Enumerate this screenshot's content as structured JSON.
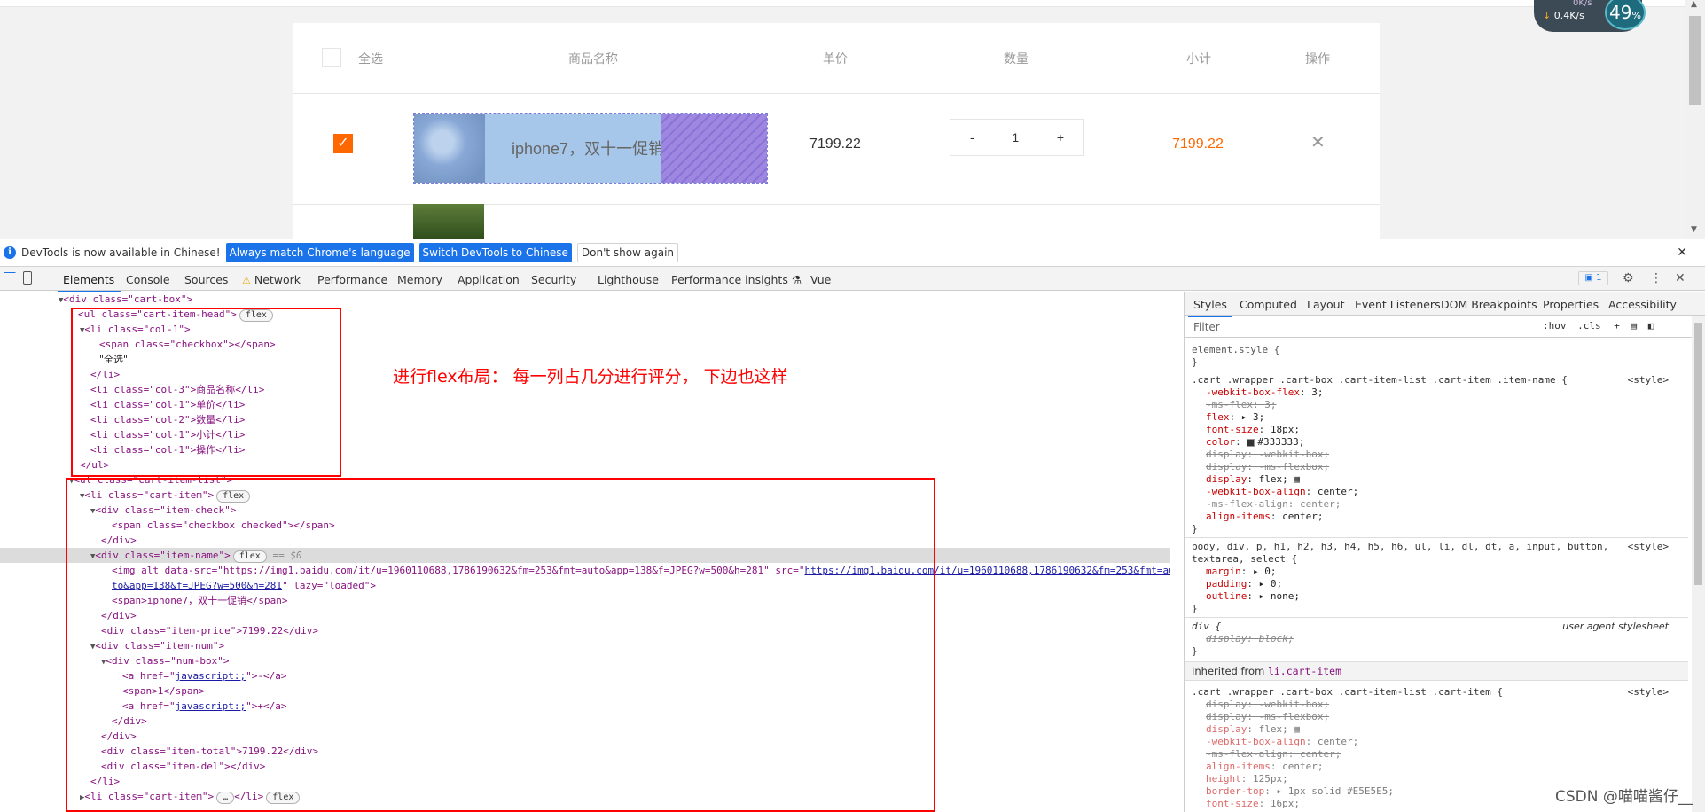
{
  "cart": {
    "head": {
      "select_all": "全选",
      "name": "商品名称",
      "price": "单价",
      "quantity": "数量",
      "subtotal": "小计",
      "operation": "操作"
    },
    "item": {
      "name": "iphone7，双十一促销",
      "price": "7199.22",
      "minus": "-",
      "quantity": "1",
      "plus": "+",
      "total": "7199.22",
      "delete": "✕"
    }
  },
  "speed_widget": {
    "up": "0K/s",
    "down": "0.4K/s",
    "percent": "49",
    "percent_unit": "%"
  },
  "infobar": {
    "message": "DevTools is now available in Chinese!",
    "btn_match": "Always match Chrome's language",
    "btn_switch": "Switch DevTools to Chinese",
    "btn_dismiss": "Don't show again",
    "close": "✕"
  },
  "tabs": [
    "Elements",
    "Console",
    "Sources",
    "Network",
    "Performance",
    "Memory",
    "Application",
    "Security",
    "Lighthouse",
    "Performance insights",
    "Vue"
  ],
  "message_badge": "1",
  "styles_tabs": [
    "Styles",
    "Computed",
    "Layout",
    "Event Listeners",
    "DOM Breakpoints",
    "Properties",
    "Accessibility"
  ],
  "filter": {
    "placeholder": "Filter",
    "hov": ":hov",
    "cls": ".cls",
    "plus": "+"
  },
  "annotation": "进行flex布局：  每一列占几分进行评分，  下边也这样",
  "dom": {
    "cart_box": "<div class=\"cart-box\">",
    "ul_head": "<ul class=\"cart-item-head\">",
    "li_col1": "<li class=\"col-1\">",
    "span_checkbox": "<span class=\"checkbox\"></span>",
    "text_all": "\"全选\"",
    "li_close": "</li>",
    "li_col3": "<li class=\"col-3\">商品名称</li>",
    "li_col1_price": "<li class=\"col-1\">单价</li>",
    "li_col2": "<li class=\"col-2\">数量</li>",
    "li_col1_total": "<li class=\"col-1\">小计</li>",
    "li_col1_op": "<li class=\"col-1\">操作</li>",
    "ul_close": "</ul>",
    "ul_list": "<ul class=\"cart-item-list\">",
    "li_item": "<li class=\"cart-item\">",
    "div_check": "<div class=\"item-check\">",
    "span_checked": "<span class=\"checkbox checked\"></span>",
    "div_close": "</div>",
    "div_name": "<div class=\"item-name\">",
    "img_line1": "<img alt data-src=\"https://img1.baidu.com/it/u=1960110688,1786190632&fm=253&fmt=auto&app=138&f=JPEG?w=500&h=281\" src=\"",
    "img_link1": "https://img1.baidu.com/it/u=1960110688,1786190632&fm=253&fmt=au",
    "img_link2": "to&app=138&f=JPEG?w=500&h=281",
    "img_line2_tail": "\" lazy=\"loaded\">",
    "span_name": "<span>iphone7，双十一促销</span>",
    "div_price": "<div class=\"item-price\">7199.22</div>",
    "div_num": "<div class=\"item-num\">",
    "div_numbox": "<div class=\"num-box\">",
    "a_open": "<a href=\"",
    "a_href": "javascript:;",
    "a_minus_tail": "\">-</a>",
    "span_one": "<span>1</span>",
    "a_plus_tail": "\">+</a>",
    "div_total": "<div class=\"item-total\">7199.22</div>",
    "div_del": "<div class=\"item-del\"></div>",
    "li_item_collapsed": "<li class=\"cart-item\">",
    "ellipsis": "…",
    "li_item_collapsed_tail": "</li>",
    "pill_flex": "flex",
    "eq_dollar": "== $0"
  },
  "styles": {
    "element_style": "element.style {",
    "close_brace": "}",
    "rule1_selector": ".cart .wrapper .cart-box .cart-item-list .cart-item .item-name {",
    "style_src": "<style>",
    "rule1_props": [
      {
        "name": "-webkit-box-flex",
        "value": "3;",
        "struck": false
      },
      {
        "name": "-ms-flex",
        "value": "3;",
        "struck": true
      },
      {
        "name": "flex",
        "value": "▸ 3;",
        "struck": false
      },
      {
        "name": "font-size",
        "value": "18px;",
        "struck": false
      },
      {
        "name": "color",
        "value": "#333333;",
        "struck": false
      },
      {
        "name": "display",
        "value": "-webkit-box;",
        "struck": true
      },
      {
        "name": "display",
        "value": "-ms-flexbox;",
        "struck": true
      },
      {
        "name": "display",
        "value": "flex;",
        "struck": false
      },
      {
        "name": "-webkit-box-align",
        "value": "center;",
        "struck": false
      },
      {
        "name": "-ms-flex-align",
        "value": "center;",
        "struck": true
      },
      {
        "name": "align-items",
        "value": "center;",
        "struck": false
      }
    ],
    "rule2_selector_1": "body, div, p, h1, h2, h3, h4, h5, h6, ul, li, dl, dt, a, input, button,",
    "rule2_selector_2": "textarea, select {",
    "rule2_props": [
      {
        "name": "margin",
        "value": "▸ 0;"
      },
      {
        "name": "padding",
        "value": "▸ 0;"
      },
      {
        "name": "outline",
        "value": "▸ none;"
      }
    ],
    "rule3_selector": "div {",
    "user_agent": "user agent stylesheet",
    "rule3_prop_name": "display",
    "rule3_prop_value": "block;",
    "inherited_label": "Inherited from ",
    "inherited_sel": "li.cart-item",
    "rule4_selector": ".cart .wrapper .cart-box .cart-item-list .cart-item {",
    "rule4_props": [
      {
        "name": "display",
        "value": "-webkit-box;",
        "struck": true
      },
      {
        "name": "display",
        "value": "-ms-flexbox;",
        "struck": true
      },
      {
        "name": "display",
        "value": "flex;",
        "struck": false
      },
      {
        "name": "-webkit-box-align",
        "value": "center;",
        "struck": false
      },
      {
        "name": "-ms-flex-align",
        "value": "center;",
        "struck": true
      },
      {
        "name": "align-items",
        "value": "center;",
        "struck": false
      },
      {
        "name": "height",
        "value": "125px;",
        "struck": false
      },
      {
        "name": "border-top",
        "value": "▸ 1px solid #E5E5E5;",
        "struck": false
      },
      {
        "name": "font-size",
        "value": "16px;",
        "struck": false
      }
    ]
  },
  "watermark": "CSDN @喵喵酱仔__",
  "colors": {
    "accent": "#ff6700",
    "devtools_blue": "#1a73e8",
    "annotation_red": "#ff0000"
  }
}
